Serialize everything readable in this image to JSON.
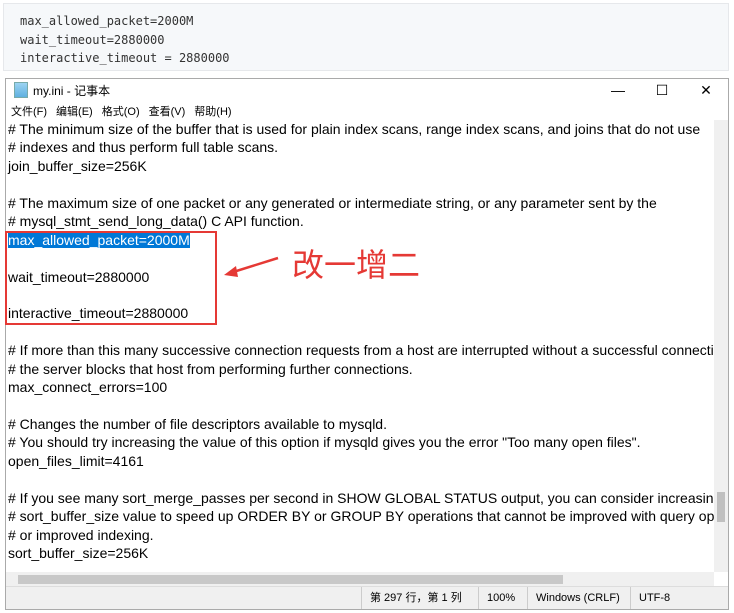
{
  "code_block": {
    "lines": [
      "max_allowed_packet=2000M",
      "wait_timeout=2880000",
      "interactive_timeout = 2880000"
    ]
  },
  "window": {
    "title": "my.ini - 记事本",
    "minimize": "—",
    "maximize": "☐",
    "close": "✕"
  },
  "menu": [
    "文件(F)",
    "编辑(E)",
    "格式(O)",
    "查看(V)",
    "帮助(H)"
  ],
  "editor_lines": [
    "# The minimum size of the buffer that is used for plain index scans, range index scans, and joins that do not use",
    "# indexes and thus perform full table scans.",
    "join_buffer_size=256K",
    "",
    "# The maximum size of one packet or any generated or intermediate string, or any parameter sent by the",
    "# mysql_stmt_send_long_data() C API function.",
    "max_allowed_packet=2000M",
    "",
    "wait_timeout=2880000",
    "",
    "interactive_timeout=2880000",
    "",
    "# If more than this many successive connection requests from a host are interrupted without a successful connection,",
    "# the server blocks that host from performing further connections.",
    "max_connect_errors=100",
    "",
    "# Changes the number of file descriptors available to mysqld.",
    "# You should try increasing the value of this option if mysqld gives you the error \"Too many open files\".",
    "open_files_limit=4161",
    "",
    "# If you see many sort_merge_passes per second in SHOW GLOBAL STATUS output, you can consider increasing the",
    "# sort_buffer_size value to speed up ORDER BY or GROUP BY operations that cannot be improved with query optimization",
    "# or improved indexing.",
    "sort_buffer_size=256K"
  ],
  "annotation": "改一增二",
  "status": {
    "position": "第 297 行，第 1 列",
    "zoom": "100%",
    "line_ending": "Windows (CRLF)",
    "encoding": "UTF-8"
  },
  "colors": {
    "selection": "#0078d7",
    "annotation": "#e53935"
  }
}
